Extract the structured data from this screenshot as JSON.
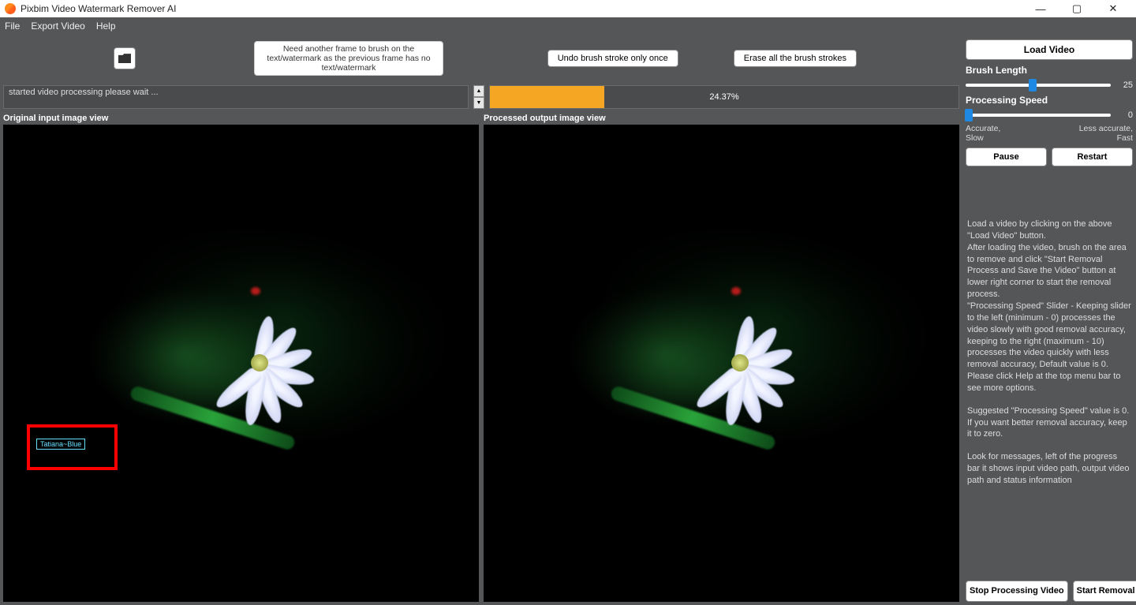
{
  "title": "Pixbim Video Watermark Remover AI",
  "menu": {
    "file": "File",
    "export": "Export Video",
    "help": "Help"
  },
  "toolbar": {
    "hint": "Need another frame to brush on the text/watermark as the previous frame has no text/watermark",
    "undo": "Undo brush stroke only once",
    "erase": "Erase all the brush strokes"
  },
  "status": {
    "log_line": "started video processing please wait ...",
    "progress_percent": "24.37%",
    "progress_value": 24.37
  },
  "views": {
    "original_label": "Original input image view",
    "processed_label": "Processed output image view",
    "watermark_text": "Tatiana~Blue"
  },
  "sidebar": {
    "load_video": "Load Video",
    "brush_length_label": "Brush Length",
    "brush_length_value": "25",
    "processing_speed_label": "Processing Speed",
    "processing_speed_value": "0",
    "speed_left": "Accurate,\nSlow",
    "speed_right": "Less accurate,\nFast",
    "pause": "Pause",
    "restart": "Restart",
    "help1": "Load a video by clicking on the above \"Load Video\" button.\nAfter loading the video, brush on the area to remove and click \"Start Removal Process and Save the Video\" button at lower right corner to start the removal process.\n\"Processing Speed\" Slider - Keeping slider to the left (minimum - 0) processes the video slowly with good removal accuracy, keeping to the right (maximum - 10) processes the video quickly with less removal accuracy, Default value is 0. Please click Help at the top menu bar to see more options.",
    "help2": "Suggested \"Processing Speed\" value is 0. If you want better removal accuracy, keep it to zero.",
    "help3": "Look for messages, left of the progress bar it shows input video path, output video path and status information",
    "stop": "Stop Processing Video",
    "start": "Start Removal Process and Save the Video"
  }
}
